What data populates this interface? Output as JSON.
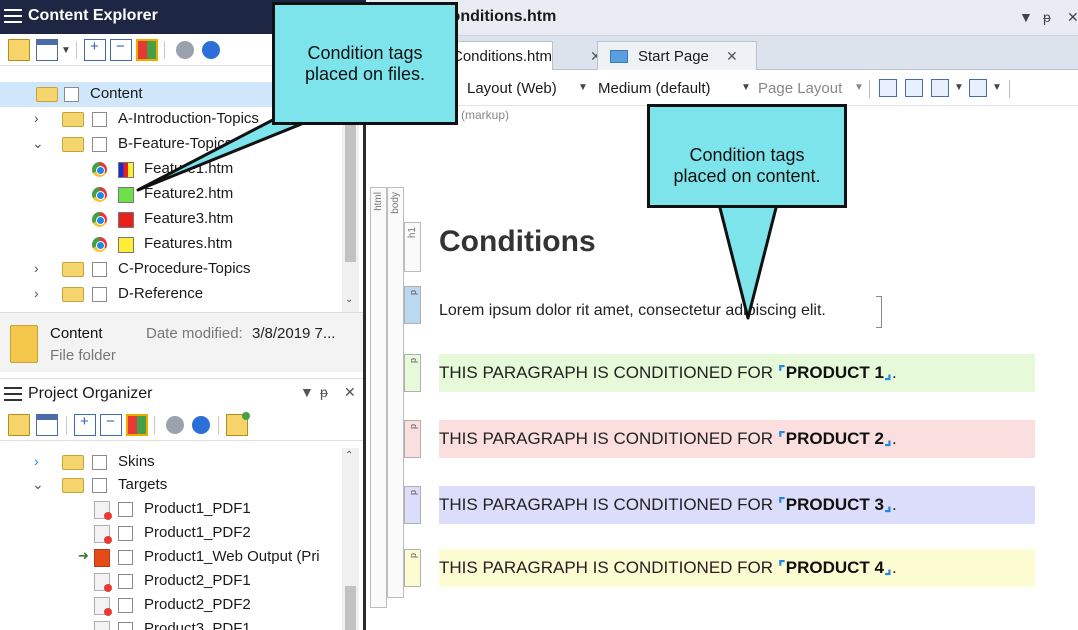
{
  "content_explorer": {
    "title": "Content Explorer",
    "tree": [
      {
        "label": "Content",
        "type": "folder-root"
      },
      {
        "label": "A-Introduction-Topics",
        "type": "folder",
        "expanded": false
      },
      {
        "label": "B-Feature-Topics",
        "type": "folder",
        "expanded": true
      },
      {
        "label": "Feature1.htm",
        "type": "file",
        "swatch": "multi"
      },
      {
        "label": "Feature2.htm",
        "type": "file",
        "swatch": "#6fe04a"
      },
      {
        "label": "Feature3.htm",
        "type": "file",
        "swatch": "#e8221a"
      },
      {
        "label": "Features.htm",
        "type": "file",
        "swatch": "#ffee33"
      },
      {
        "label": "C-Procedure-Topics",
        "type": "folder",
        "expanded": false
      },
      {
        "label": "D-Reference",
        "type": "folder",
        "expanded": false
      }
    ],
    "info": {
      "name": "Content",
      "date_label": "Date modified:",
      "date_value": "3/8/2019 7...",
      "file_type": "File folder"
    }
  },
  "project_organizer": {
    "title": "Project Organizer",
    "pin": "ᵖ",
    "tree": [
      {
        "label": "Skins",
        "type": "folder"
      },
      {
        "label": "Targets",
        "type": "folder"
      },
      {
        "label": "Product1_PDF1",
        "type": "pdf"
      },
      {
        "label": "Product1_PDF2",
        "type": "pdf"
      },
      {
        "label": "Product1_Web Output (Pri",
        "type": "web"
      },
      {
        "label": "Product2_PDF1",
        "type": "pdf"
      },
      {
        "label": "Product2_PDF2",
        "type": "pdf"
      },
      {
        "label": "Product3_PDF1",
        "type": "pdf"
      }
    ]
  },
  "editor": {
    "window_title": "Conditions.htm",
    "tabs": [
      {
        "label": "Conditions.htm",
        "active": true
      },
      {
        "label": "Start Page",
        "active": false
      }
    ],
    "toolbar": {
      "layout": "Layout (Web)",
      "medium": "Medium (default)",
      "page_layout": "Page Layout"
    },
    "markup_note": "(markup)",
    "structure": {
      "html": "html",
      "body": "body",
      "h1": "h1",
      "p": "p"
    },
    "heading": "Conditions",
    "lorem": "Lorem ipsum dolor rit amet, consectetur adipiscing elit.",
    "paragraphs": [
      {
        "text": "THIS PARAGRAPH IS CONDITIONED FOR ",
        "product": "PRODUCT 1",
        "color": "#e6f9d8"
      },
      {
        "text": "THIS PARAGRAPH IS CONDITIONED FOR ",
        "product": "PRODUCT 2",
        "color": "#fbdede"
      },
      {
        "text": "THIS PARAGRAPH IS CONDITIONED FOR ",
        "product": "PRODUCT 3",
        "color": "#dcdcfb"
      },
      {
        "text": "THIS PARAGRAPH IS CONDITIONED FOR ",
        "product": "PRODUCT 4",
        "color": "#fdfbd2"
      }
    ]
  },
  "callouts": {
    "files": "Condition tags placed on files.",
    "content": "Condition tags placed on content."
  },
  "colors": {
    "callout": "#7de4ec",
    "header": "#1d2744",
    "selected_row": "#cfe6fb"
  }
}
